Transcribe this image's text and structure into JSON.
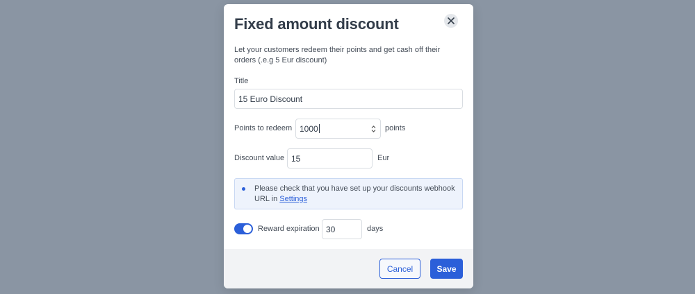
{
  "modal": {
    "title": "Fixed amount discount",
    "description": "Let your customers redeem their points and get cash off their orders (.e.g 5 Eur discount)",
    "close_icon": "close-icon"
  },
  "form": {
    "title_label": "Title",
    "title_value": "15 Euro Discount",
    "points_label": "Points to redeem",
    "points_value": "1000",
    "points_unit": "points",
    "discount_label": "Discount value",
    "discount_value": "15",
    "discount_unit": "Eur",
    "notice_text": "Please check that you have set up your discounts webhook URL in",
    "notice_link": "Settings",
    "expiration_enabled": true,
    "expiration_label": "Reward expiration",
    "expiration_value": "30",
    "expiration_unit": "days"
  },
  "footer": {
    "cancel_label": "Cancel",
    "save_label": "Save"
  },
  "colors": {
    "accent": "#2b5fd9",
    "backdrop": "#8a95a3",
    "notice_bg": "#eef3fc"
  }
}
